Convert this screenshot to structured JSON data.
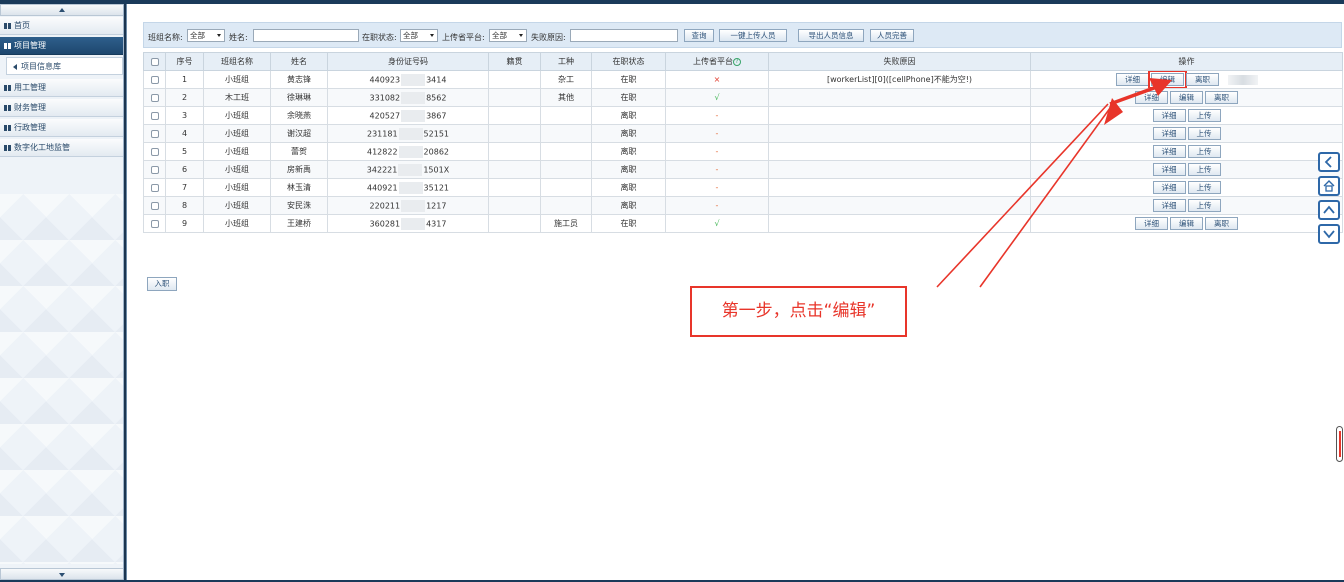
{
  "sidebar": {
    "items": [
      {
        "label": "首页",
        "active": false
      },
      {
        "label": "项目管理",
        "active": true
      },
      {
        "label": "项目信息库",
        "sub": true
      },
      {
        "label": "用工管理",
        "active": false
      },
      {
        "label": "财务管理",
        "active": false
      },
      {
        "label": "行政管理",
        "active": false
      },
      {
        "label": "数字化工地监管",
        "active": false
      }
    ]
  },
  "filter": {
    "team_label": "班组名称:",
    "team_value": "全部",
    "name_label": "姓名:",
    "name_value": "",
    "status_label": "在职状态:",
    "status_value": "全部",
    "platform_label": "上传省平台:",
    "platform_value": "全部",
    "reason_label": "失败原因:",
    "reason_value": "",
    "buttons": [
      "查询",
      "一键上传人员",
      "导出人员信息",
      "人员完善"
    ]
  },
  "table": {
    "headers": [
      "",
      "序号",
      "班组名称",
      "姓名",
      "身份证号码",
      "籍贯",
      "工种",
      "在职状态",
      "上传省平台",
      "失败原因",
      "操作"
    ],
    "rows": [
      {
        "no": "1",
        "team": "小班组",
        "name": "黄志锋",
        "id_start": "440923",
        "id_end": "3414",
        "origin": "",
        "job": "杂工",
        "status": "在职",
        "upload": "×",
        "upload_kind": "x",
        "reason": "[workerList][0]([cellPhone]不能为空!)",
        "actions": [
          "详细",
          "编辑",
          "离职"
        ]
      },
      {
        "no": "2",
        "team": "木工班",
        "name": "徐琳琳",
        "id_start": "331082",
        "id_end": "8562",
        "origin": "",
        "job": "其他",
        "status": "在职",
        "upload": "√",
        "upload_kind": "ok",
        "reason": "",
        "actions": [
          "详细",
          "编辑",
          "离职"
        ]
      },
      {
        "no": "3",
        "team": "小班组",
        "name": "余晓燕",
        "id_start": "420527",
        "id_end": "3867",
        "origin": "",
        "job": "",
        "status": "离职",
        "upload": "-",
        "upload_kind": "dash",
        "reason": "",
        "actions": [
          "详细",
          "上传"
        ]
      },
      {
        "no": "4",
        "team": "小班组",
        "name": "谢汉超",
        "id_start": "231181",
        "id_end": "52151",
        "origin": "",
        "job": "",
        "status": "离职",
        "upload": "-",
        "upload_kind": "dash",
        "reason": "",
        "actions": [
          "详细",
          "上传"
        ]
      },
      {
        "no": "5",
        "team": "小班组",
        "name": "蕾贺",
        "id_start": "412822",
        "id_end": "20862",
        "origin": "",
        "job": "",
        "status": "离职",
        "upload": "-",
        "upload_kind": "dash",
        "reason": "",
        "actions": [
          "详细",
          "上传"
        ]
      },
      {
        "no": "6",
        "team": "小班组",
        "name": "房新禹",
        "id_start": "342221",
        "id_end": "1501X",
        "origin": "",
        "job": "",
        "status": "离职",
        "upload": "-",
        "upload_kind": "dash",
        "reason": "",
        "actions": [
          "详细",
          "上传"
        ]
      },
      {
        "no": "7",
        "team": "小班组",
        "name": "林玉清",
        "id_start": "440921",
        "id_end": "35121",
        "origin": "",
        "job": "",
        "status": "离职",
        "upload": "-",
        "upload_kind": "dash",
        "reason": "",
        "actions": [
          "详细",
          "上传"
        ]
      },
      {
        "no": "8",
        "team": "小班组",
        "name": "安民洙",
        "id_start": "220211",
        "id_end": "1217",
        "origin": "",
        "job": "",
        "status": "离职",
        "upload": "-",
        "upload_kind": "dash",
        "reason": "",
        "actions": [
          "详细",
          "上传"
        ]
      },
      {
        "no": "9",
        "team": "小班组",
        "name": "王建桥",
        "id_start": "360281",
        "id_end": "4317",
        "origin": "",
        "job": "施工员",
        "status": "在职",
        "upload": "√",
        "upload_kind": "ok",
        "reason": "",
        "actions": [
          "详细",
          "编辑",
          "离职"
        ]
      }
    ]
  },
  "enter_button": "入职",
  "callout": "第一步，点击“编辑”",
  "colors": {
    "accent": "#1e476e",
    "annotation": "#e8352a",
    "ok": "#36b24a",
    "fail": "#e03a2c"
  },
  "icons": [
    "chevron-left-icon",
    "home-icon",
    "chevron-up-icon",
    "chevron-down-icon"
  ]
}
